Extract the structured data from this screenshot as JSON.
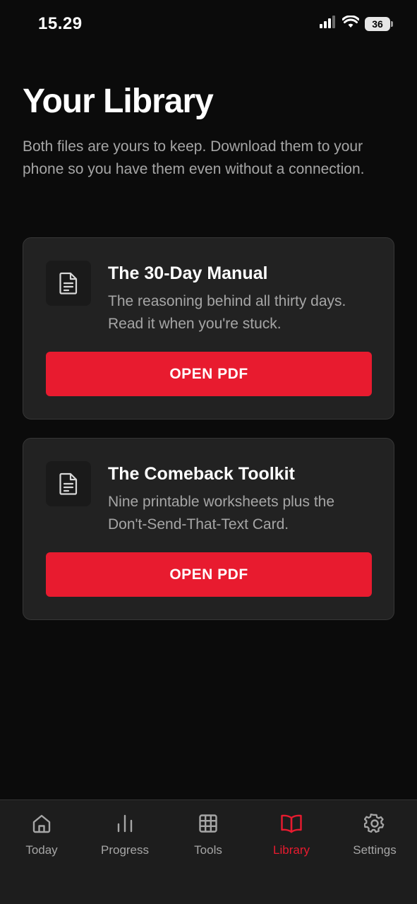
{
  "status_bar": {
    "time": "15.29",
    "battery": "36"
  },
  "header": {
    "title": "Your Library",
    "intro": "Both files are yours to keep. Download them to your phone so you have them even without a connection."
  },
  "library_items": [
    {
      "icon": "document-icon",
      "title": "The 30-Day Manual",
      "description": "The reasoning behind all thirty days. Read it when you're stuck.",
      "button_label": "OPEN PDF"
    },
    {
      "icon": "document-icon",
      "title": "The Comeback Toolkit",
      "description": "Nine printable worksheets plus the Don't-Send-That-Text Card.",
      "button_label": "OPEN PDF"
    }
  ],
  "tab_bar": {
    "active": "Library",
    "tabs": [
      {
        "label": "Today",
        "icon": "home-icon"
      },
      {
        "label": "Progress",
        "icon": "bar-chart-icon"
      },
      {
        "label": "Tools",
        "icon": "grid-icon"
      },
      {
        "label": "Library",
        "icon": "book-icon"
      },
      {
        "label": "Settings",
        "icon": "gear-icon"
      }
    ]
  },
  "colors": {
    "background": "#0b0b0b",
    "card": "#222222",
    "accent": "#e81b2f",
    "muted_text": "#a6a6a6"
  }
}
